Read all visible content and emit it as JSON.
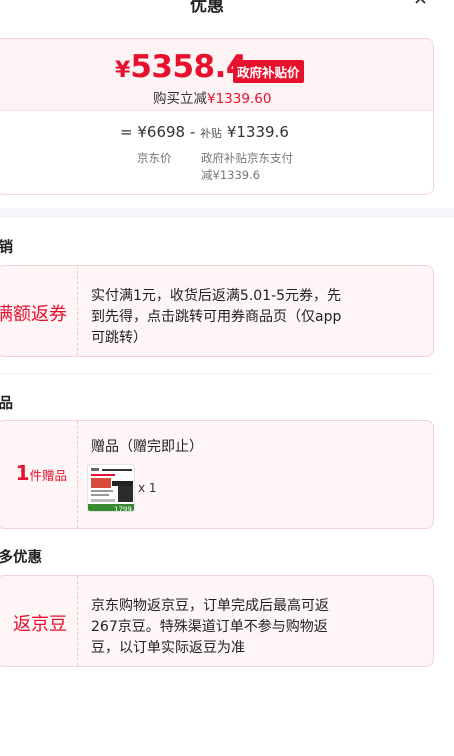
{
  "header": {
    "title": "优惠"
  },
  "price_card": {
    "currency": "¥",
    "final_price": "5358.4",
    "badge": "政府补贴价",
    "immediate_label": "购买立减",
    "immediate_amount": "¥1339.60",
    "calc": {
      "equals": "=",
      "jd_price": "¥6698",
      "minus": "-",
      "subsidy_label": "补贴",
      "subsidy_amount": "¥1339.6"
    },
    "jd_price_caption": "京东价",
    "subsidy_caption_line1": "政府补贴京东支付",
    "subsidy_caption_line2": "减¥1339.6"
  },
  "sections": {
    "promo": {
      "title": "促销",
      "tag": "满额返券",
      "desc_lines": [
        "实付满1元，收货后返满5.01-5元券，先",
        "到先得，点击跳转可用券商品页（仅app",
        "可跳转）"
      ]
    },
    "gift": {
      "title": "赠品",
      "count": "1",
      "unit": "件赠品",
      "heading": "赠品（赠完即止）",
      "thumb_price": "1799",
      "quantity": "x 1"
    },
    "more": {
      "title": "更多优惠",
      "tag": "返京豆",
      "desc_lines": [
        "京东购物返京豆，订单完成后最高可返",
        "267京豆。特殊渠道订单不参与购物返",
        "豆，以订单实际返豆为准"
      ]
    }
  },
  "colors": {
    "accent": "#e8112d",
    "card_bg": "#fdf5f6",
    "card_border": "#f3d3d6"
  }
}
